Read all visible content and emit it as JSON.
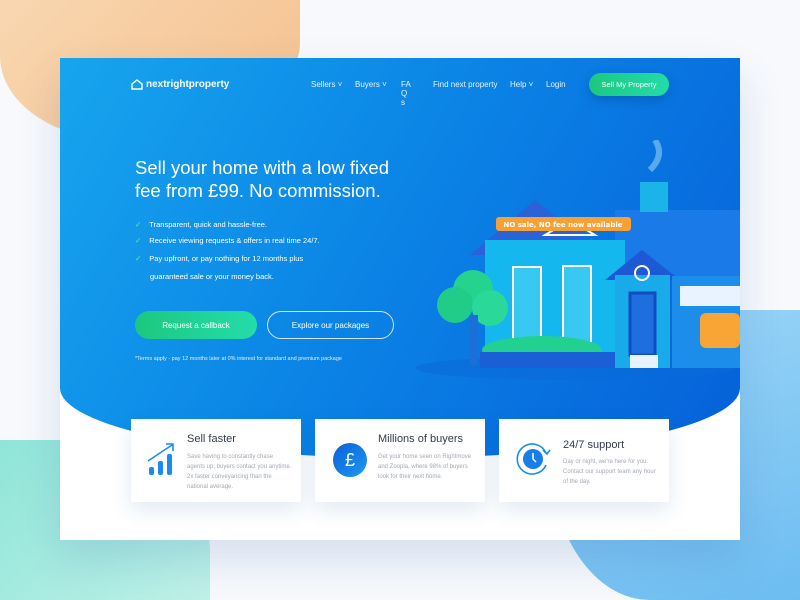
{
  "nav": {
    "logo": "nextrightproperty",
    "items": [
      "Sellers",
      "Buyers",
      "FAQs",
      "Find next property",
      "Help",
      "Login"
    ],
    "cta": "Sell My Property"
  },
  "hero": {
    "title": "Sell your home with a low fixed fee from £99. No commission.",
    "bullets": [
      "Transparent, quick and hassle-free.",
      "Receive viewing requests & offers in real time 24/7.",
      "Pay upfront, or pay nothing for 12 months plus",
      "guaranteed sale or your money back."
    ],
    "primary_button": "Request a callback",
    "secondary_button": "Explore our packages",
    "terms": "*Terms apply - pay 12 months later at 0% interest for standard and premium package",
    "banner": "NO sale, NO fee now available"
  },
  "features": [
    {
      "title": "Sell faster",
      "text": "Save having to constantly chase agents up, buyers contact you anytime. 2x faster conveyancing than the national average.",
      "icon": "chart-growth-icon"
    },
    {
      "title": "Millions of buyers",
      "text": "Get your home seen on Rightmove and Zoopla, where 98% of buyers look for their next home.",
      "icon": "pound-icon"
    },
    {
      "title": "24/7 support",
      "text": "Day or night, we're here for you. Contact our support team any hour of the day.",
      "icon": "clock-icon"
    }
  ],
  "colors": {
    "primary": "#0b85e6",
    "accent": "#1cc87f",
    "banner": "#f7a035"
  }
}
